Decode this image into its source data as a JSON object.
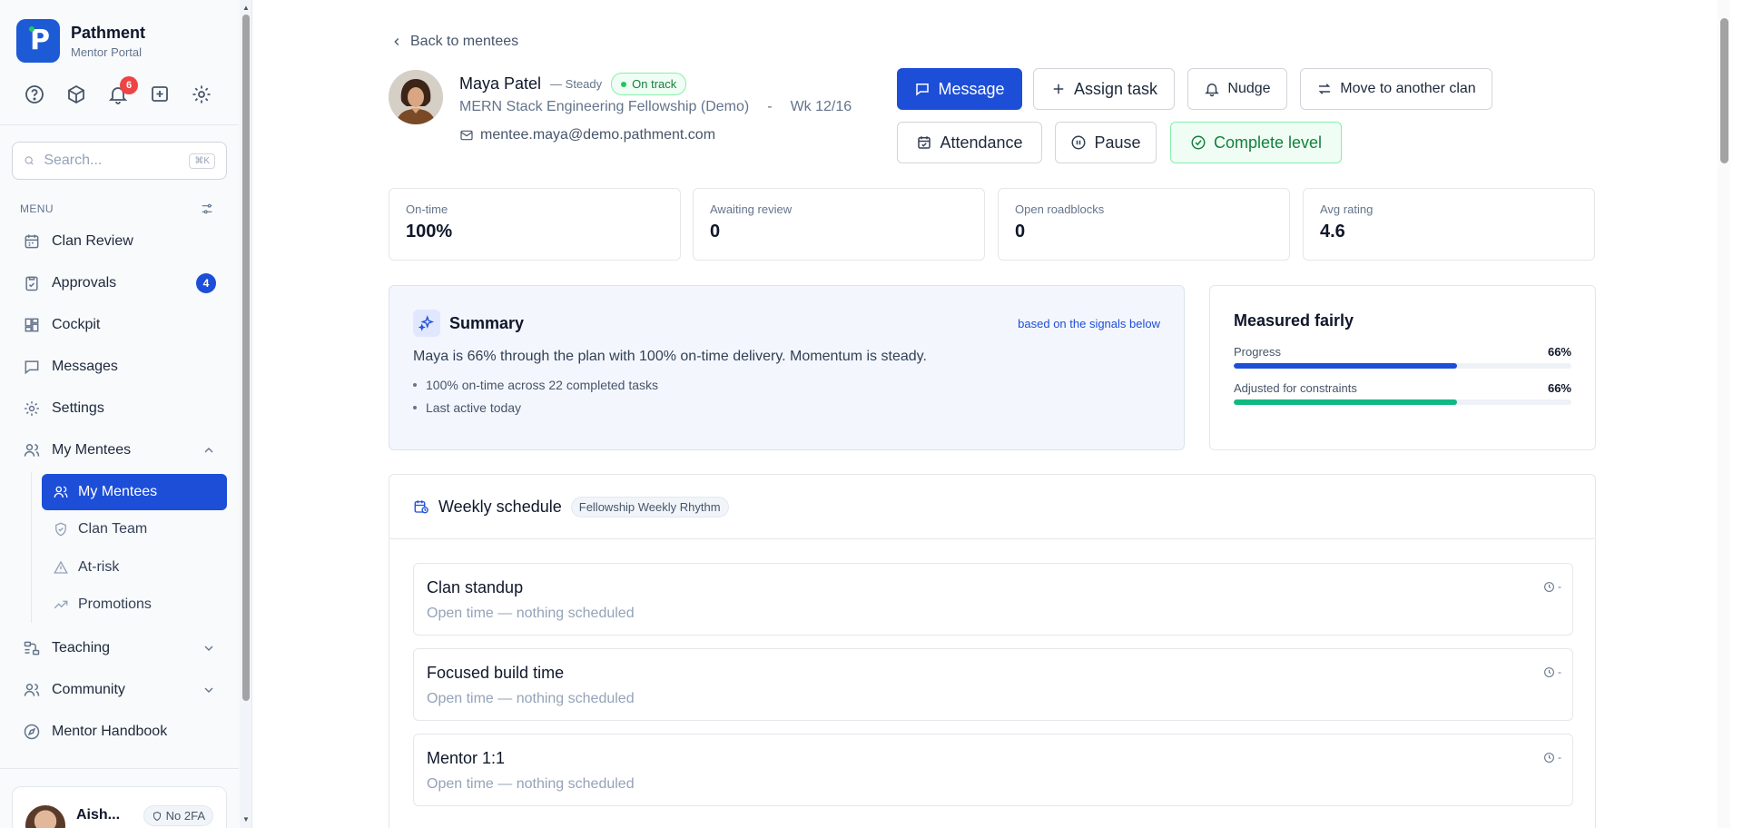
{
  "brand": {
    "name": "Pathment",
    "subtitle": "Mentor Portal",
    "logo_letter": "P"
  },
  "toolbar": {
    "notifications_count": "6"
  },
  "search": {
    "placeholder": "Search...",
    "shortcut": "⌘K"
  },
  "menu": {
    "heading": "MENU",
    "items": [
      {
        "label": "Clan Review",
        "icon": "calendar-icon"
      },
      {
        "label": "Approvals",
        "icon": "clipboard-check-icon",
        "badge": "4"
      },
      {
        "label": "Cockpit",
        "icon": "grid-icon"
      },
      {
        "label": "Messages",
        "icon": "message-icon"
      },
      {
        "label": "Settings",
        "icon": "gear-icon"
      },
      {
        "label": "My Mentees",
        "icon": "users-icon",
        "expanded": true
      }
    ],
    "sub_items": [
      {
        "label": "My Mentees",
        "icon": "users-icon",
        "active": true
      },
      {
        "label": "Clan Team",
        "icon": "shield-icon"
      },
      {
        "label": "At-risk",
        "icon": "warning-icon"
      },
      {
        "label": "Promotions",
        "icon": "trending-up-icon"
      }
    ],
    "more": [
      {
        "label": "Teaching",
        "icon": "flow-icon"
      },
      {
        "label": "Community",
        "icon": "users-icon"
      },
      {
        "label": "Mentor Handbook",
        "icon": "compass-icon"
      }
    ]
  },
  "user": {
    "name": "Aish...",
    "twofa": "No 2FA"
  },
  "mentee": {
    "back_label": "Back to mentees",
    "name": "Maya Patel",
    "momentum": "— Steady",
    "status": "On track",
    "program": "MERN Stack Engineering Fellowship (Demo)",
    "separator": "-",
    "week": "Wk 12/16",
    "email": "mentee.maya@demo.pathment.com"
  },
  "actions": {
    "message": "Message",
    "assign_task": "Assign task",
    "nudge": "Nudge",
    "move": "Move to another clan",
    "attendance": "Attendance",
    "pause": "Pause",
    "complete": "Complete level"
  },
  "stats": [
    {
      "label": "On-time",
      "value": "100%"
    },
    {
      "label": "Awaiting review",
      "value": "0"
    },
    {
      "label": "Open roadblocks",
      "value": "0"
    },
    {
      "label": "Avg rating",
      "value": "4.6"
    }
  ],
  "summary": {
    "title": "Summary",
    "link": "based on the signals below",
    "text": "Maya is 66% through the plan with 100% on-time delivery. Momentum is steady.",
    "bullets": [
      "100% on-time across 22 completed tasks",
      "Last active today"
    ]
  },
  "fairness": {
    "title": "Measured fairly",
    "bars": [
      {
        "label": "Progress",
        "pct_label": "66%",
        "value": 0.66,
        "color": "#1d4ed8"
      },
      {
        "label": "Adjusted for constraints",
        "pct_label": "66%",
        "value": 0.66,
        "color": "#10b981"
      }
    ]
  },
  "weekly": {
    "title": "Weekly schedule",
    "tag": "Fellowship Weekly Rhythm",
    "slots": [
      {
        "name": "Clan standup",
        "sub": "Open time — nothing scheduled",
        "time": "-"
      },
      {
        "name": "Focused build time",
        "sub": "Open time — nothing scheduled",
        "time": "-"
      },
      {
        "name": "Mentor 1:1",
        "sub": "Open time — nothing scheduled",
        "time": "-"
      }
    ]
  },
  "colors": {
    "primary": "#1d4ed8",
    "success": "#15803d",
    "danger": "#ef4444"
  }
}
